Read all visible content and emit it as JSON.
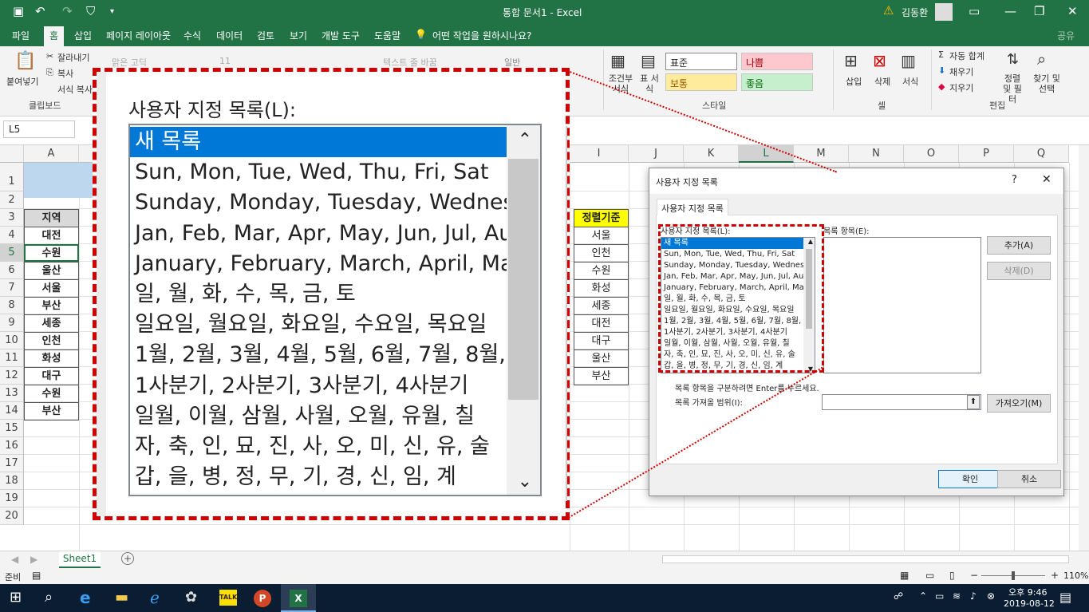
{
  "window": {
    "title": "통합 문서1 - Excel",
    "user": "김동환",
    "warning_icon": "warning-icon"
  },
  "tabs": [
    "파일",
    "홈",
    "삽입",
    "페이지 레이아웃",
    "수식",
    "데이터",
    "검토",
    "보기",
    "개발 도구",
    "도움말"
  ],
  "active_tab": "홈",
  "tell_me": "어떤 작업을 원하시나요?",
  "share": "공유",
  "ribbon": {
    "paste": "붙여넣기",
    "cut": "잘라내기",
    "copy": "복사",
    "format_painter": "서식 복사",
    "clipboard": "클립보드",
    "font_name": "맑은 고딕",
    "font_size": "11",
    "wrap_text": "텍스트 줄 바꿈",
    "number_format": "일반",
    "conditional": "조건부 서식",
    "table_format": "표 서식",
    "styles": {
      "normal": "표준",
      "bad": "나쁨",
      "neutral": "보통",
      "good": "좋음"
    },
    "style_group": "스타일",
    "insert": "삽입",
    "delete": "삭제",
    "format": "서식",
    "cells_group": "셀",
    "autosum": "자동 합계",
    "fill": "채우기",
    "clear": "지우기",
    "sort_filter": "정렬 및 필터",
    "find_select": "찾기 및 선택",
    "editing_group": "편집"
  },
  "name_box": "L5",
  "columns": [
    "A",
    "I",
    "J",
    "K",
    "L",
    "M",
    "N",
    "O",
    "P",
    "Q"
  ],
  "rows": [
    "1",
    "2",
    "3",
    "4",
    "5",
    "6",
    "7",
    "8",
    "9",
    "10",
    "11",
    "12",
    "13",
    "14",
    "15",
    "16",
    "17",
    "18",
    "19",
    "20"
  ],
  "col_a": {
    "header": "지역",
    "values": [
      "대전",
      "수원",
      "울산",
      "서울",
      "부산",
      "세종",
      "인천",
      "화성",
      "대구",
      "수원",
      "부산"
    ]
  },
  "col_i": {
    "header": "정렬기준",
    "values": [
      "서울",
      "인천",
      "수원",
      "화성",
      "세종",
      "대전",
      "대구",
      "울산",
      "부산"
    ]
  },
  "sheet_tab": "Sheet1",
  "status": {
    "ready": "준비",
    "zoom": "110%"
  },
  "taskbar": {
    "time": "오후 9:46",
    "date": "2019-08-12"
  },
  "dialog": {
    "title": "사용자 지정 목록",
    "help": "?",
    "close": "✕",
    "tab": "사용자 지정 목록",
    "lists_label": "사용자 지정 목록(L):",
    "entries_label": "목록 항목(E):",
    "add": "추가(A)",
    "delete": "삭제(D)",
    "hint": "목록 항목을 구분하려면 Enter를 누르세요.",
    "import_label": "목록 가져올 범위(I):",
    "import_btn": "가져오기(M)",
    "ok": "확인",
    "cancel": "취소"
  },
  "custom_lists": [
    "새 목록",
    "Sun, Mon, Tue, Wed, Thu, Fri, Sat",
    "Sunday, Monday, Tuesday, Wednesday",
    "Jan, Feb, Mar, Apr, May, Jun, Jul, Aug",
    "January, February, March, April, May",
    "일, 월, 화, 수, 목, 금, 토",
    "일요일, 월요일, 화요일, 수요일, 목요일",
    "1월, 2월, 3월, 4월, 5월, 6월, 7월, 8월,",
    "1사분기, 2사분기, 3사분기, 4사분기",
    "일월, 이월, 삼월, 사월, 오월, 유월, 칠",
    "자, 축, 인, 묘, 진, 사, 오, 미, 신, 유, 술",
    "갑, 을, 병, 정, 무, 기, 경, 신, 임, 계"
  ],
  "zoom_label": "사용자 지정 목록(L):",
  "colors": {
    "excel_green": "#217346",
    "highlight": "#0078d7",
    "callout": "#d10000",
    "header_yellow": "#ffff00",
    "row1_blue": "#bdd7ee"
  }
}
